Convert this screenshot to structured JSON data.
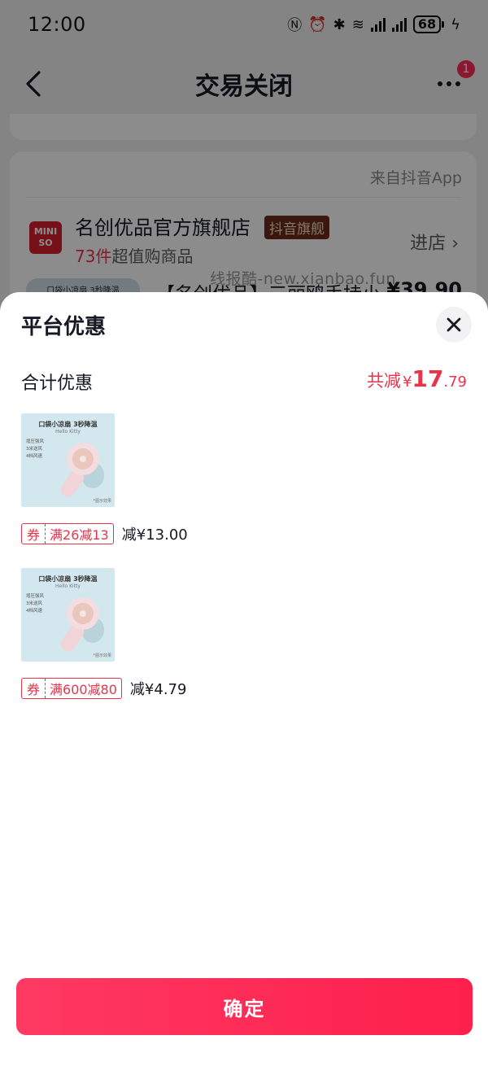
{
  "status_bar": {
    "time": "12:00",
    "battery": "68"
  },
  "header": {
    "title": "交易关闭",
    "badge_count": "1"
  },
  "store_card": {
    "source": "来自抖音App",
    "store_name": "名创优品官方旗舰店",
    "store_tag": "抖音旗舰",
    "count": "73件",
    "count_suffix": "超值购商品",
    "enter_store": "进店",
    "logo_text": "MINI SO",
    "product_title": "【名创优品】三丽鸥手持小",
    "product_price": "¥39.90",
    "product_thumb_text": "口袋小凉扇 3秒降温"
  },
  "watermark": "线报酷-new.xianbao.fun",
  "sheet": {
    "title": "平台优惠",
    "total_label": "合计优惠",
    "total_prefix": "共减",
    "total_currency": "¥",
    "total_int": "17",
    "total_dec": ".79",
    "items": [
      {
        "image_title": "口袋小凉扇 3秒降温",
        "image_sub": "Hello Kitty",
        "features": [
          "增压强风",
          "3米送风",
          "4档风速"
        ],
        "image_note": "*图示效果",
        "coupon_tag": "券",
        "coupon_rule": "满26减13",
        "saving": "减¥13.00"
      },
      {
        "image_title": "口袋小凉扇 3秒降温",
        "image_sub": "Hello Kitty",
        "features": [
          "增压强风",
          "3米送风",
          "4档风速"
        ],
        "image_note": "*图示效果",
        "coupon_tag": "券",
        "coupon_rule": "满600减80",
        "saving": "减¥4.79"
      }
    ],
    "confirm_label": "确定"
  },
  "colors": {
    "accent": "#fe2c55",
    "discount_red": "#e8334a",
    "store_tag_bg": "#6b2d1d"
  }
}
